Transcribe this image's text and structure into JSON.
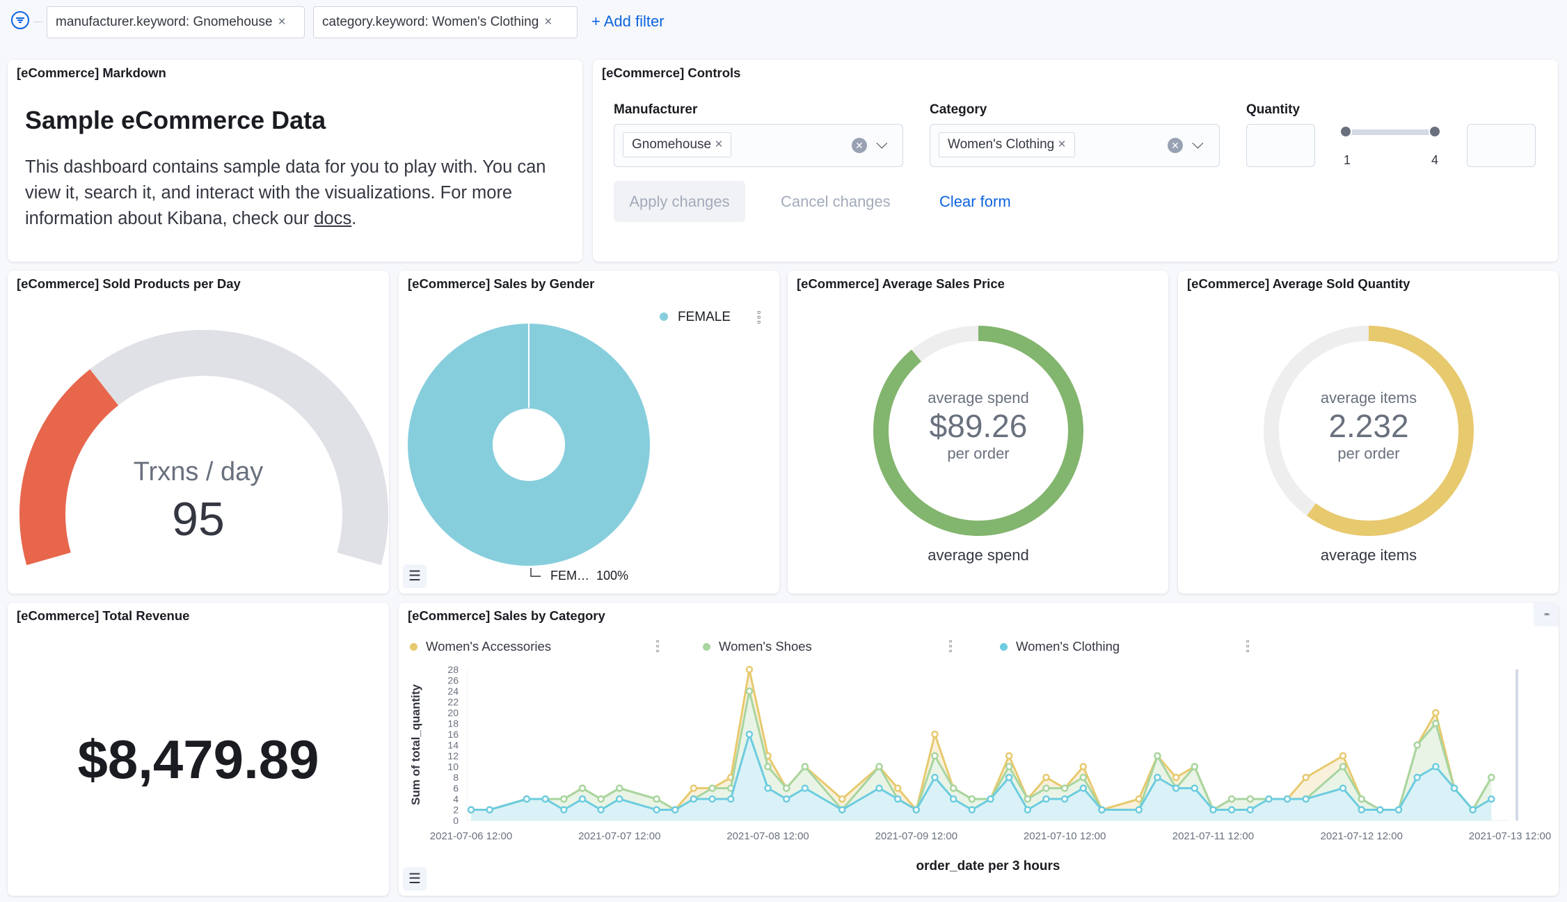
{
  "filter_bar": {
    "filters": [
      {
        "label": "manufacturer.keyword: Gnomehouse"
      },
      {
        "label": "category.keyword: Women's Clothing"
      }
    ],
    "remove_glyph": "×",
    "add_filter": "+ Add filter"
  },
  "markdown_panel": {
    "title": "[eCommerce] Markdown",
    "heading": "Sample eCommerce Data",
    "body": "This dashboard contains sample data for you to play with. You can view it, search it, and interact with the visualizations. For more information about Kibana, check our ",
    "link": "docs",
    "end": "."
  },
  "controls_panel": {
    "title": "[eCommerce] Controls",
    "manufacturer": {
      "label": "Manufacturer",
      "value": "Gnomehouse"
    },
    "category": {
      "label": "Category",
      "value": "Women's Clothing"
    },
    "quantity": {
      "label": "Quantity",
      "min_label": "1",
      "max_label": "4",
      "min_value": "",
      "max_value": ""
    },
    "apply": "Apply changes",
    "cancel": "Cancel changes",
    "clear": "Clear form"
  },
  "sold_products_panel": {
    "title": "[eCommerce] Sold Products per Day",
    "label": "Trxns / day",
    "value": "95",
    "fill_fraction": 0.32,
    "fill_color": "#e7664c",
    "track_color": "#e0e1e6"
  },
  "gender_panel": {
    "title": "[eCommerce] Sales by Gender",
    "legend": "FEMALE",
    "slice_label": "FEM…",
    "slice_percent": "100%",
    "color": "#87cedd",
    "chart_data": {
      "type": "pie",
      "categories": [
        "FEMALE"
      ],
      "values": [
        100
      ]
    }
  },
  "avg_price_panel": {
    "title": "[eCommerce] Average Sales Price",
    "top": "average spend",
    "value": "$89.26",
    "sub": "per order",
    "bottom": "average spend",
    "fill_fraction": 0.89,
    "color": "#82b56d"
  },
  "avg_qty_panel": {
    "title": "[eCommerce] Average Sold Quantity",
    "top": "average items",
    "value": "2.232",
    "sub": "per order",
    "bottom": "average items",
    "fill_fraction": 0.6,
    "color": "#e7c96e"
  },
  "revenue_panel": {
    "title": "[eCommerce] Total Revenue",
    "value": "$8,479.89"
  },
  "category_panel": {
    "title": "[eCommerce] Sales by Category",
    "options_glyph": "▫▫▫"
  },
  "chart_data": {
    "type": "area",
    "stacked": true,
    "ylabel": "Sum of total_quantity",
    "xlabel": "order_date per 3 hours",
    "ylim": [
      0,
      28
    ],
    "yticks": [
      "0",
      "2",
      "4",
      "6",
      "8",
      "10",
      "12",
      "14",
      "16",
      "18",
      "20",
      "22",
      "24",
      "26",
      "28"
    ],
    "xlim": [
      "2021-07-06 12:00",
      "2021-07-13 12:00"
    ],
    "xticks": [
      "2021-07-06 12:00",
      "2021-07-07 12:00",
      "2021-07-08 12:00",
      "2021-07-09 12:00",
      "2021-07-10 12:00",
      "2021-07-11 12:00",
      "2021-07-12 12:00",
      "2021-07-13 12:00"
    ],
    "legend_position": "top",
    "x": [
      "2021-07-06 12:00",
      "2021-07-06 15:00",
      "2021-07-06 21:00",
      "2021-07-07 00:00",
      "2021-07-07 03:00",
      "2021-07-07 06:00",
      "2021-07-07 09:00",
      "2021-07-07 12:00",
      "2021-07-07 18:00",
      "2021-07-07 21:00",
      "2021-07-08 00:00",
      "2021-07-08 03:00",
      "2021-07-08 06:00",
      "2021-07-08 09:00",
      "2021-07-08 12:00",
      "2021-07-08 15:00",
      "2021-07-08 18:00",
      "2021-07-09 00:00",
      "2021-07-09 06:00",
      "2021-07-09 09:00",
      "2021-07-09 12:00",
      "2021-07-09 15:00",
      "2021-07-09 18:00",
      "2021-07-09 21:00",
      "2021-07-10 00:00",
      "2021-07-10 03:00",
      "2021-07-10 06:00",
      "2021-07-10 09:00",
      "2021-07-10 12:00",
      "2021-07-10 15:00",
      "2021-07-10 18:00",
      "2021-07-11 00:00",
      "2021-07-11 03:00",
      "2021-07-11 06:00",
      "2021-07-11 09:00",
      "2021-07-11 12:00",
      "2021-07-11 15:00",
      "2021-07-11 18:00",
      "2021-07-11 21:00",
      "2021-07-12 00:00",
      "2021-07-12 03:00",
      "2021-07-12 09:00",
      "2021-07-12 12:00",
      "2021-07-12 15:00",
      "2021-07-12 18:00",
      "2021-07-12 21:00",
      "2021-07-13 00:00",
      "2021-07-13 03:00",
      "2021-07-13 06:00",
      "2021-07-13 09:00"
    ],
    "series": [
      {
        "name": "Women's Clothing",
        "color": "#6dccdf",
        "values": [
          2,
          2,
          4,
          4,
          2,
          4,
          2,
          4,
          2,
          2,
          4,
          4,
          4,
          16,
          6,
          4,
          6,
          2,
          6,
          4,
          2,
          8,
          4,
          2,
          4,
          8,
          2,
          4,
          4,
          6,
          2,
          2,
          8,
          6,
          6,
          2,
          2,
          2,
          4,
          4,
          4,
          6,
          2,
          2,
          2,
          8,
          10,
          6,
          2,
          4
        ]
      },
      {
        "name": "Women's Shoes",
        "color": "#a8d5a0",
        "values": [
          0,
          0,
          0,
          0,
          2,
          2,
          2,
          2,
          2,
          0,
          0,
          2,
          2,
          8,
          4,
          2,
          4,
          0,
          4,
          0,
          0,
          4,
          2,
          2,
          0,
          2,
          2,
          2,
          2,
          2,
          0,
          0,
          4,
          0,
          4,
          0,
          2,
          2,
          0,
          0,
          0,
          4,
          2,
          0,
          0,
          6,
          8,
          0,
          0,
          4
        ]
      },
      {
        "name": "Women's Accessories",
        "color": "#e7c96e",
        "values": [
          0,
          0,
          0,
          0,
          0,
          0,
          0,
          0,
          0,
          0,
          2,
          0,
          2,
          4,
          2,
          0,
          0,
          2,
          0,
          2,
          0,
          4,
          0,
          0,
          0,
          2,
          0,
          2,
          0,
          2,
          0,
          2,
          0,
          2,
          0,
          0,
          0,
          0,
          0,
          0,
          4,
          2,
          0,
          0,
          0,
          0,
          2,
          0,
          0,
          0
        ]
      }
    ]
  }
}
